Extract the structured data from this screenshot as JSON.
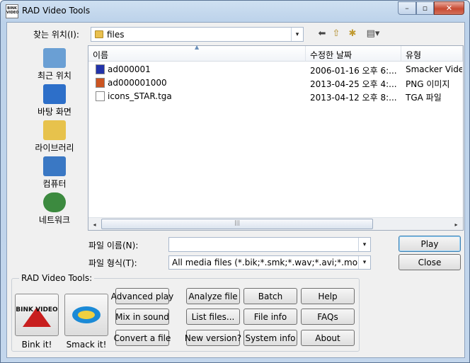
{
  "window": {
    "title": "RAD Video Tools",
    "app_icon_text": "BINK VIDEO",
    "min_glyph": "–",
    "max_glyph": "▫",
    "close_glyph": "✕"
  },
  "lookin": {
    "label": "찾는 위치(I):",
    "value": "files",
    "arrow": "▾"
  },
  "toolbar": {
    "back_glyph": "⬅",
    "up_glyph": "⇧",
    "newfolder_glyph": "✱",
    "view_glyph": "▤▾"
  },
  "places": [
    {
      "label": "최근 위치",
      "icon": "recent-places-icon",
      "color": "#6a9fd4"
    },
    {
      "label": "바탕 화면",
      "icon": "desktop-icon",
      "color": "#2d6fc9"
    },
    {
      "label": "라이브러리",
      "icon": "libraries-icon",
      "color": "#e7c24c"
    },
    {
      "label": "컴퓨터",
      "icon": "computer-icon",
      "color": "#3a78c4"
    },
    {
      "label": "네트워크",
      "icon": "network-icon",
      "color": "#3c8a3f"
    }
  ],
  "columns": [
    {
      "label": "이름"
    },
    {
      "label": "수정한 날짜"
    },
    {
      "label": "유형"
    }
  ],
  "sort_glyph": "▲",
  "files": [
    {
      "name": "ad000001",
      "date": "2006-01-16 오후 6:...",
      "type": "Smacker Video",
      "icon_color": "#2233aa"
    },
    {
      "name": "ad000001000",
      "date": "2013-04-25 오후 4:...",
      "type": "PNG 이미지",
      "icon_color": "#cc5522"
    },
    {
      "name": "icons_STAR.tga",
      "date": "2013-04-12 오후 8:...",
      "type": "TGA 파일",
      "icon_color": "#ffffff"
    }
  ],
  "hscroll": {
    "left": "◂",
    "right": "▸",
    "grip": "|||"
  },
  "filename": {
    "label": "파일 이름(N):",
    "value": "",
    "arrow": "▾"
  },
  "filetype": {
    "label": "파일 형식(T):",
    "value": "All media files (*.bik;*.smk;*.wav;*.avi;*.mov;",
    "arrow": "▾"
  },
  "buttons": {
    "play": "Play",
    "close": "Close"
  },
  "tools": {
    "title": "RAD Video Tools:",
    "bink_label": "Bink it!",
    "bink_tile_text": "BINK VIDEO",
    "smack_label": "Smack it!",
    "grid": [
      [
        "Advanced play",
        "Analyze file",
        "Batch",
        "Help"
      ],
      [
        "Mix in sound",
        "List files...",
        "File info",
        "FAQs"
      ],
      [
        "Convert a file",
        "New version?",
        "System info",
        "About"
      ]
    ]
  }
}
